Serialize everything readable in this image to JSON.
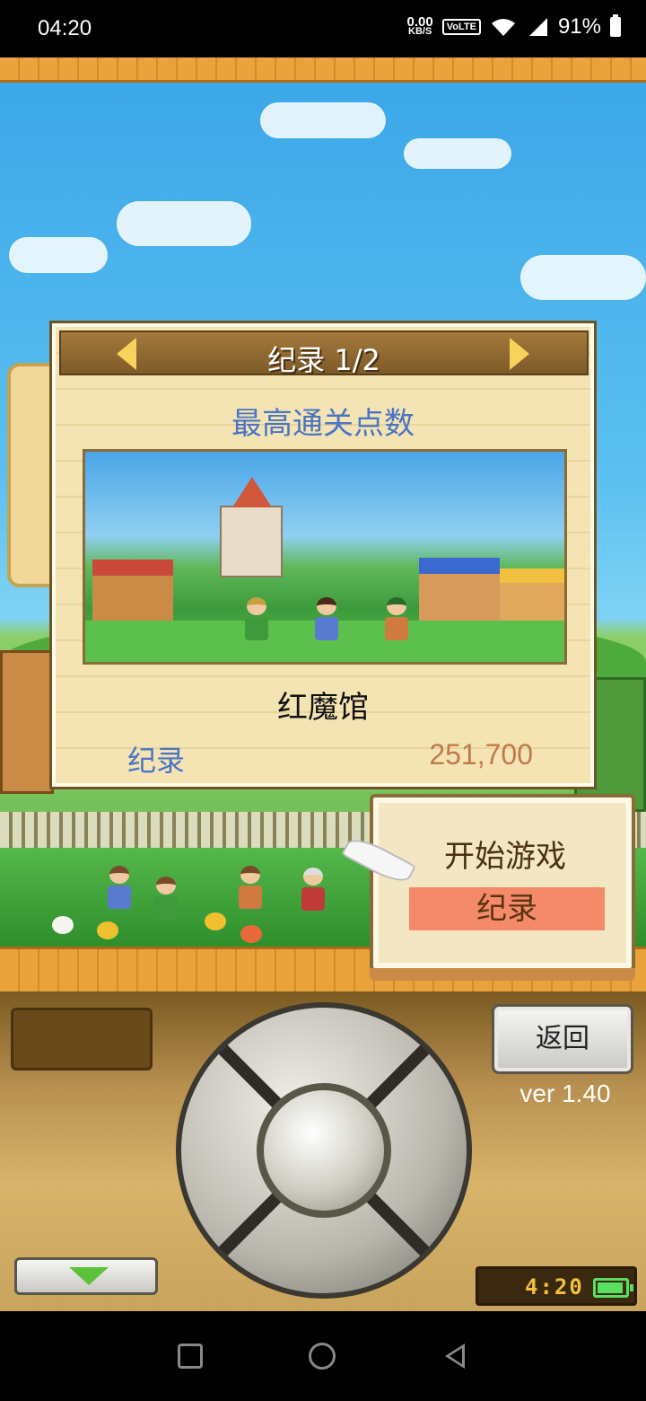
{
  "status_bar": {
    "time": "04:20",
    "net_speed_value": "0.00",
    "net_speed_unit": "KB/S",
    "volte": "VoLTE",
    "battery": "91%"
  },
  "dialog": {
    "title": "纪录 1/2",
    "subtitle": "最高通关点数",
    "place_name": "红魔馆",
    "record_label": "纪录",
    "record_value": "251,700"
  },
  "menu": {
    "start_game": "开始游戏",
    "records": "纪录",
    "selected_color": "#f58a6a"
  },
  "controls": {
    "back_label": "返回",
    "version": "ver 1.40",
    "clock": "4:20"
  },
  "icons": {
    "dialog_prev": "arrow-left-icon",
    "dialog_next": "arrow-right-icon",
    "down": "down-arrow-icon",
    "battery": "battery-icon",
    "nav_recents": "square-icon",
    "nav_home": "circle-icon",
    "nav_back": "triangle-back-icon"
  }
}
